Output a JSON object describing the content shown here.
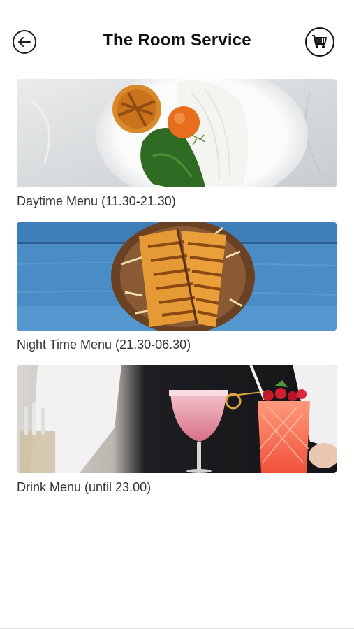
{
  "header": {
    "title": "The Room Service",
    "back_icon": "arrow-left-icon",
    "cart_icon": "shopping-cart-icon"
  },
  "menus": [
    {
      "label": "Daytime Menu (11.30-21.30)",
      "image": "grilled-fish-plate"
    },
    {
      "label": "Night Time Menu (21.30-06.30)",
      "image": "grilled-sandwich"
    },
    {
      "label": "Drink Menu (until 23.00)",
      "image": "cocktails"
    }
  ]
}
